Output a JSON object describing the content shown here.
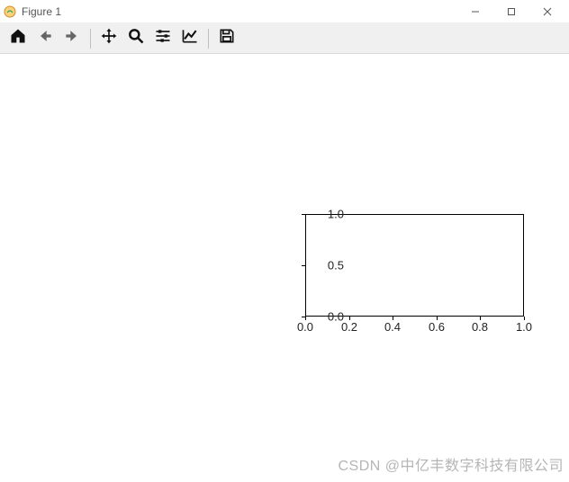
{
  "window": {
    "title": "Figure 1"
  },
  "toolbar": {
    "home": "home",
    "back": "back",
    "forward": "forward",
    "pan": "pan",
    "zoom": "zoom",
    "configure": "configure",
    "edit_axes": "edit-axes",
    "save": "save"
  },
  "watermark": "CSDN @中亿丰数字科技有限公司",
  "chart_data": {
    "type": "line",
    "series": [],
    "x": [],
    "title": "",
    "xlabel": "",
    "ylabel": "",
    "xlim": [
      0.0,
      1.0
    ],
    "ylim": [
      0.0,
      1.0
    ],
    "xticks": [
      0.0,
      0.2,
      0.4,
      0.6,
      0.8,
      1.0
    ],
    "yticks": [
      0.0,
      0.5,
      1.0
    ],
    "xtick_labels": [
      "0.0",
      "0.2",
      "0.4",
      "0.6",
      "0.8",
      "1.0"
    ],
    "ytick_labels": [
      "0.0",
      "0.5",
      "1.0"
    ],
    "grid": false
  }
}
